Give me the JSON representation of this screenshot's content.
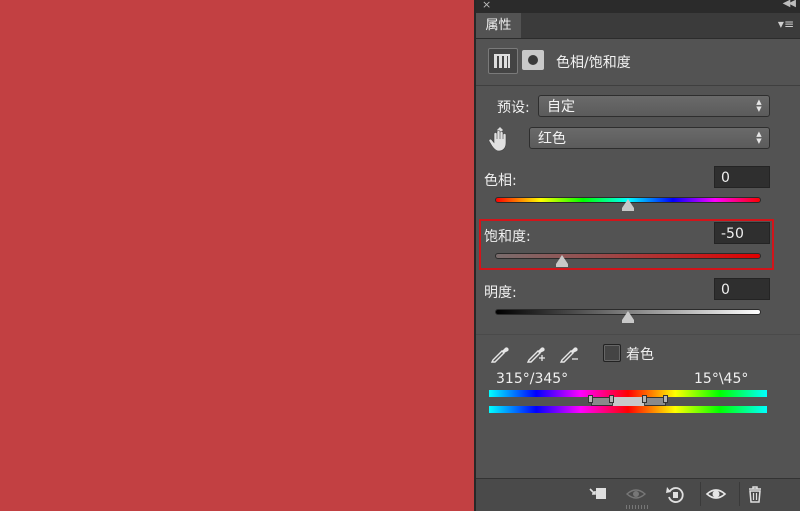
{
  "window": {
    "close_glyph": "×",
    "collapse_glyph": "◀◀"
  },
  "panel": {
    "tab_label": "属性",
    "tab_menu_glyph": "▾≡",
    "title": "色相/饱和度",
    "preset_label": "预设:",
    "preset_value": "自定",
    "channel_value": "红色"
  },
  "hue": {
    "label": "色相:",
    "value": "0",
    "slider_level": 0.5
  },
  "saturation": {
    "label": "饱和度:",
    "value": "-50",
    "slider_level": 0.25
  },
  "lightness": {
    "label": "明度:",
    "value": "0",
    "slider_level": 0.5
  },
  "colorize": {
    "label": "着色",
    "checked": false
  },
  "range": {
    "left_label": "315°/345°",
    "right_label": "15°\\45°"
  },
  "colors": {
    "canvas": "#c24042",
    "panel": "#535353",
    "highlight": "#d2141a"
  },
  "icons": {
    "adjustment": "hue-saturation-icon",
    "mask": "mask-icon",
    "hand": "targeted-adjustment-hand-icon",
    "eyedropper": "eyedropper-icon",
    "eyedropper_add": "eyedropper-add-icon",
    "eyedropper_subtract": "eyedropper-subtract-icon",
    "clip": "clip-to-layer-icon",
    "view_previous": "view-previous-state-icon",
    "reset": "reset-icon",
    "visibility": "eye-icon",
    "delete": "trash-icon"
  }
}
